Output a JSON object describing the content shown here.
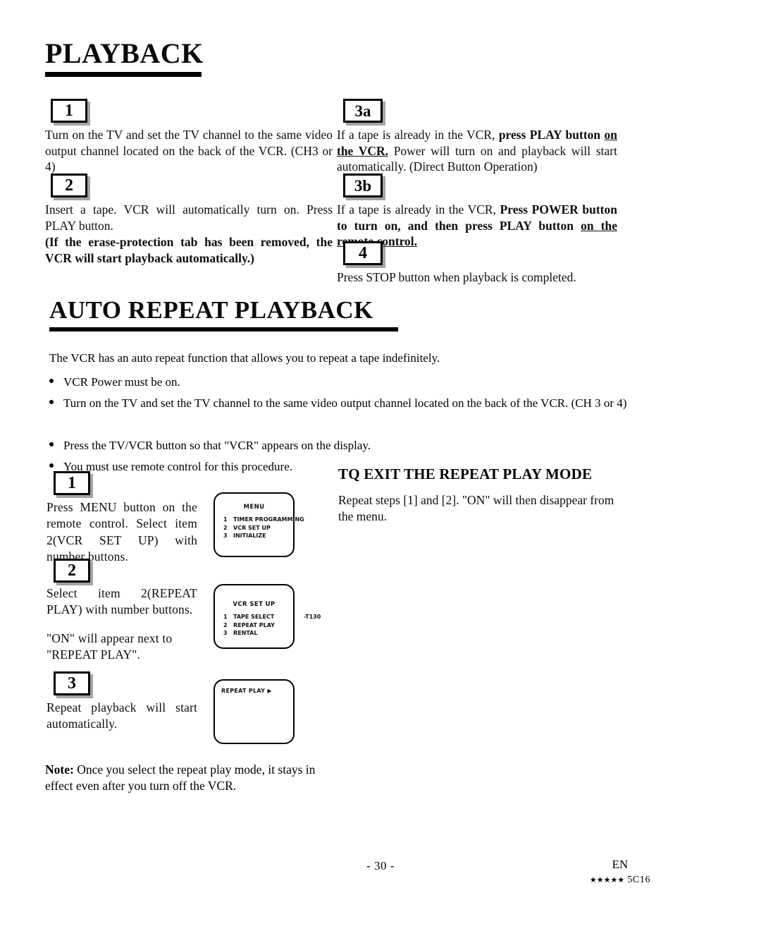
{
  "document": {
    "page_number_label": "- 30 -",
    "language_code": "EN",
    "model_code": "5C16",
    "stars": "★★★★★"
  },
  "sections": [
    {
      "id": "playback",
      "heading": "PLAYBACK"
    },
    {
      "id": "auto_repeat",
      "heading": "AUTO REPEAT PLAYBACK"
    }
  ],
  "playback": {
    "steps": {
      "s1": {
        "badge": "1",
        "text": "Turn on the TV and set the TV channel to the same video output channel located on the back of the VCR. (CH3 or 4)"
      },
      "s2": {
        "badge": "2",
        "text": "Insert a tape. VCR will automatically turn on. Press PLAY button.",
        "bold_note": "(If the erase-protection tab has been removed, the VCR will start playback automatically.)"
      },
      "s3a": {
        "badge": "3a",
        "text_lead": "If a tape is already in the VCR, ",
        "text_bold": "press PLAY button ",
        "text_bold_underline": "on the VCR.",
        "text_tail": " Power will turn on and playback will start automatically. (Direct Button Operation)"
      },
      "s3b": {
        "badge": "3b",
        "text_lead": "If a tape is already in the VCR, ",
        "text_bold": "Press POWER button to turn on, and then press PLAY button ",
        "text_bold_underline": "on the remote control."
      },
      "s4": {
        "badge": "4",
        "text": "Press STOP button when playback is completed."
      }
    }
  },
  "auto_repeat": {
    "intro": "The VCR has an auto repeat function that allows you to repeat a tape indefinitely.",
    "bullets": [
      "VCR Power must be on.",
      "Turn on the TV and set the TV channel to the same video output channel located on the back of the VCR. (CH 3 or 4)",
      "Press the TV/VCR button so that \"VCR\" appears on the display.",
      "You must use remote control for this procedure."
    ],
    "steps": {
      "s1": {
        "badge": "1",
        "text": "Press MENU button on the remote control. Select item 2(VCR SET UP) with number buttons."
      },
      "s2": {
        "badge": "2",
        "text": "Select item 2(REPEAT PLAY) with number buttons.",
        "text2": "\"ON\" will appear next to \"REPEAT PLAY\"."
      },
      "s3": {
        "badge": "3",
        "text": "Repeat playback will start automatically."
      }
    },
    "screens": [
      {
        "title": "MENU",
        "items": [
          {
            "num": "1",
            "label": "TIMER PROGRAMMING",
            "suffix": ""
          },
          {
            "num": "2",
            "label": "VCR SET UP",
            "suffix": ""
          },
          {
            "num": "3",
            "label": "INITIALIZE",
            "suffix": ""
          }
        ]
      },
      {
        "title": "VCR SET UP",
        "items": [
          {
            "num": "1",
            "label": "TAPE SELECT",
            "suffix": "-T130"
          },
          {
            "num": "2",
            "label": "REPEAT PLAY",
            "suffix": ""
          },
          {
            "num": "3",
            "label": "RENTAL",
            "suffix": ""
          }
        ]
      },
      {
        "title": "",
        "single_line": "REPEAT PLAY  ▶"
      }
    ],
    "exit": {
      "heading": "TQ EXIT THE REPEAT PLAY MODE",
      "text": "Repeat steps [1] and [2]. \"ON\" will then disappear from the menu."
    },
    "note": {
      "label": "Note:",
      "text": " Once you select the repeat play mode, it stays in effect even after you turn off the VCR."
    }
  }
}
